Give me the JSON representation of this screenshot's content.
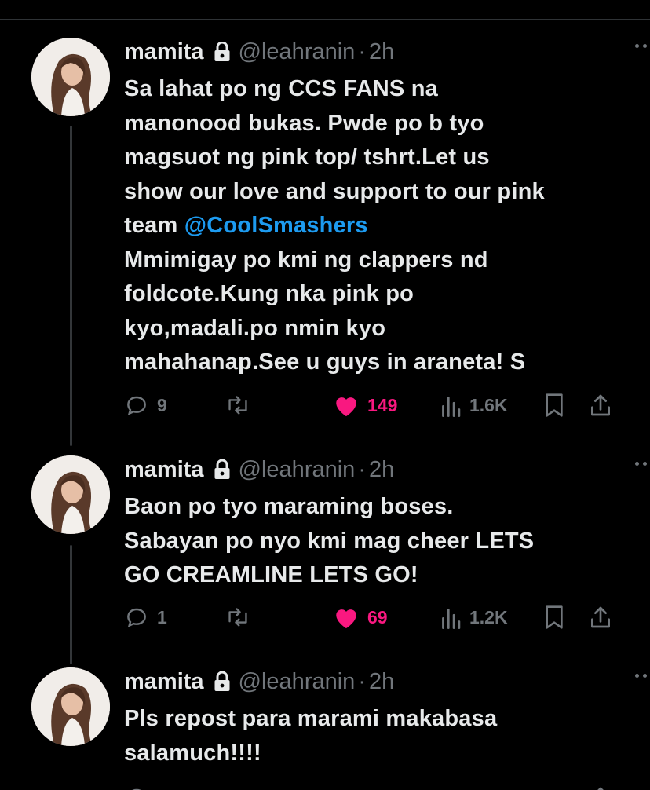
{
  "colors": {
    "background": "#000000",
    "text": "#e7e9ea",
    "muted": "#71767b",
    "link": "#1d9bf0",
    "like": "#f91880"
  },
  "posts": [
    {
      "display_name": "mamita",
      "handle": "@leahranin",
      "separator": "·",
      "time": "2h",
      "text_before": "Sa lahat po ng CCS FANS na\nmanonood bukas. Pwde po b tyo\nmagsuot ng pink top/ tshrt.Let us\nshow our love and support to our pink\nteam ",
      "mention": "@CoolSmashers",
      "text_after": "\nMmimigay po kmi ng clappers nd\nfoldcote.Kung nka pink po\nkyo,madali.po nmin kyo\nmahahanap.See u guys in araneta! S",
      "replies": "9",
      "reposts": "",
      "likes": "149",
      "views": "1.6K",
      "liked": true
    },
    {
      "display_name": "mamita",
      "handle": "@leahranin",
      "separator": "·",
      "time": "2h",
      "text_before": "Baon po tyo maraming boses.\nSabayan po nyo kmi mag cheer LETS\nGO CREAMLINE LETS GO!",
      "mention": "",
      "text_after": "",
      "replies": "1",
      "reposts": "",
      "likes": "69",
      "views": "1.2K",
      "liked": true
    },
    {
      "display_name": "mamita",
      "handle": "@leahranin",
      "separator": "·",
      "time": "2h",
      "text_before": "Pls repost para marami makabasa\nsalamuch!!!!",
      "mention": "",
      "text_after": "",
      "replies": "",
      "reposts": "",
      "likes": "",
      "views": "",
      "liked": true
    }
  ]
}
